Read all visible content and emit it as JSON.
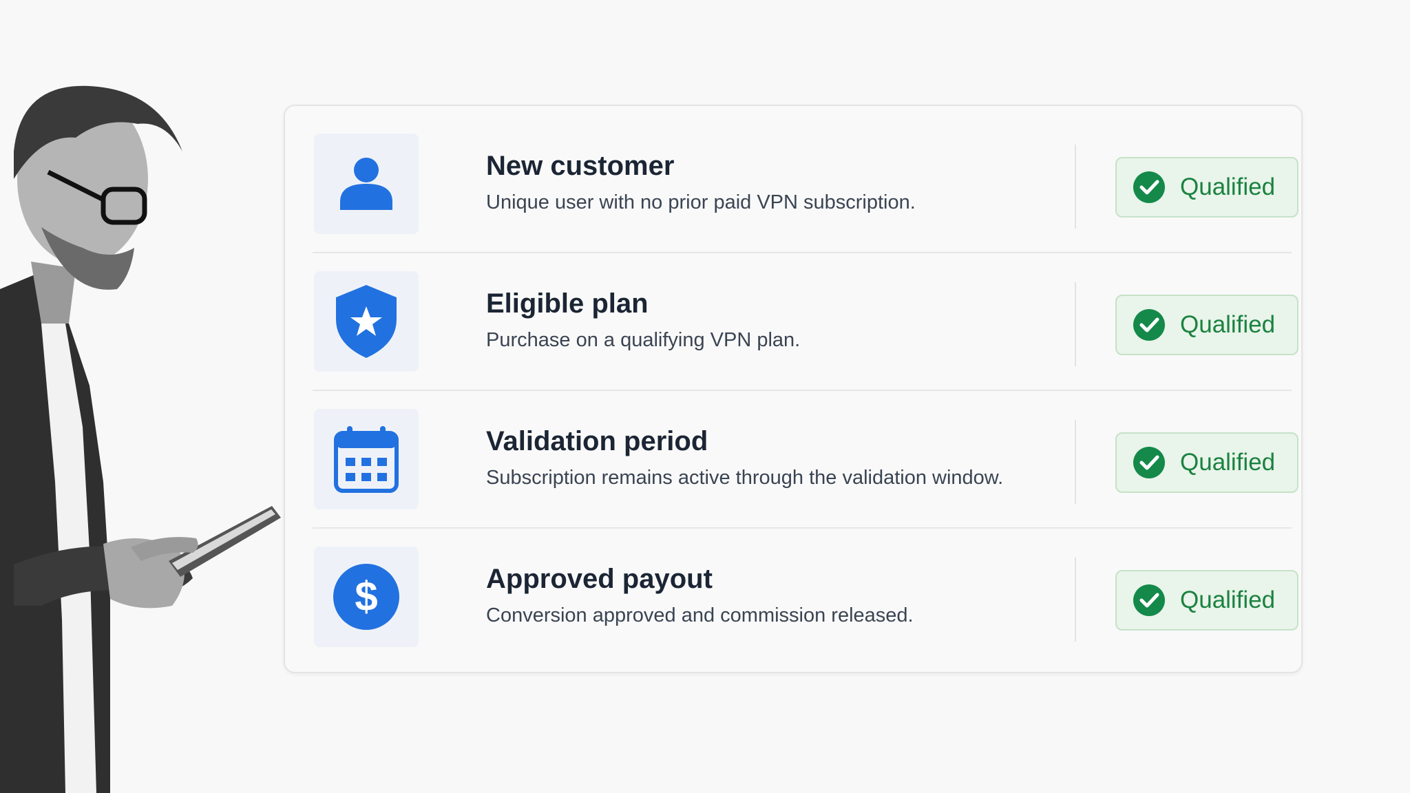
{
  "colors": {
    "accent": "#2271e0",
    "success": "#14894a",
    "success_bg": "#e9f4ea",
    "title": "#1b2534"
  },
  "criteria": [
    {
      "icon": "user-icon",
      "title": "New customer",
      "description": "Unique user with no prior paid VPN subscription.",
      "status": "Qualified"
    },
    {
      "icon": "shield-star-icon",
      "title": "Eligible plan",
      "description": "Purchase on a qualifying VPN plan.",
      "status": "Qualified"
    },
    {
      "icon": "calendar-icon",
      "title": "Validation period",
      "description": "Subscription remains active through the validation window.",
      "status": "Qualified"
    },
    {
      "icon": "dollar-icon",
      "title": "Approved payout",
      "description": "Conversion approved and commission released.",
      "status": "Qualified"
    }
  ]
}
